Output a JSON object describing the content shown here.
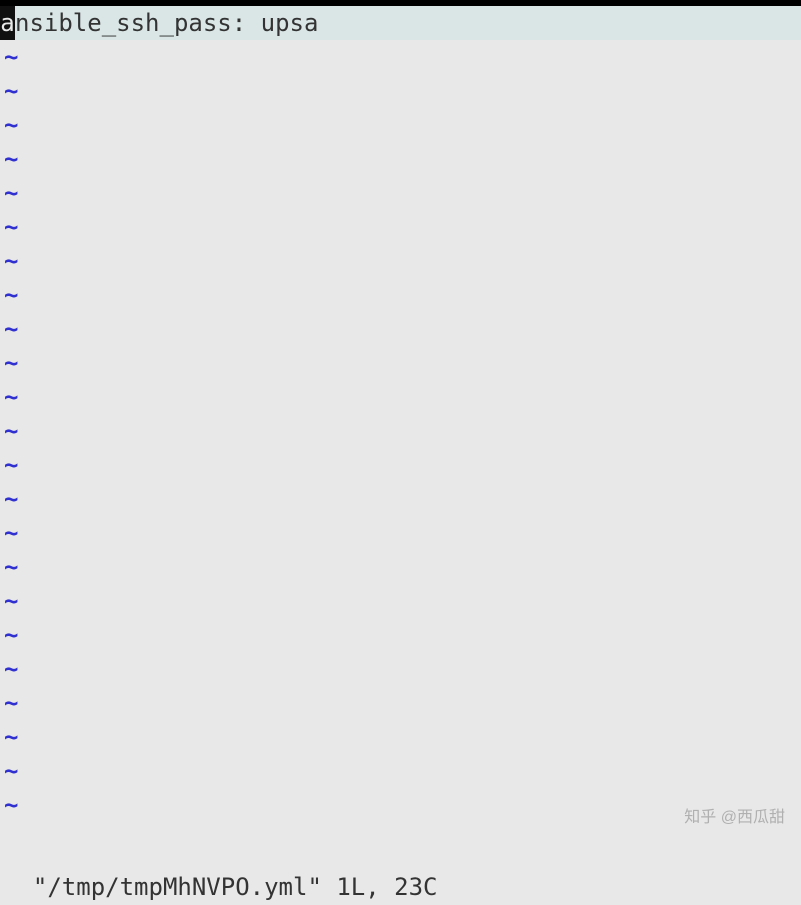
{
  "editor": {
    "cursor_char": "a",
    "content_rest": "nsible_ssh_pass: upsa",
    "tilde": "~",
    "tilde_count": 23
  },
  "status": {
    "text": "\"/tmp/tmpMhNVPO.yml\" 1L, 23C"
  },
  "watermark": {
    "text": "知乎 @西瓜甜"
  }
}
